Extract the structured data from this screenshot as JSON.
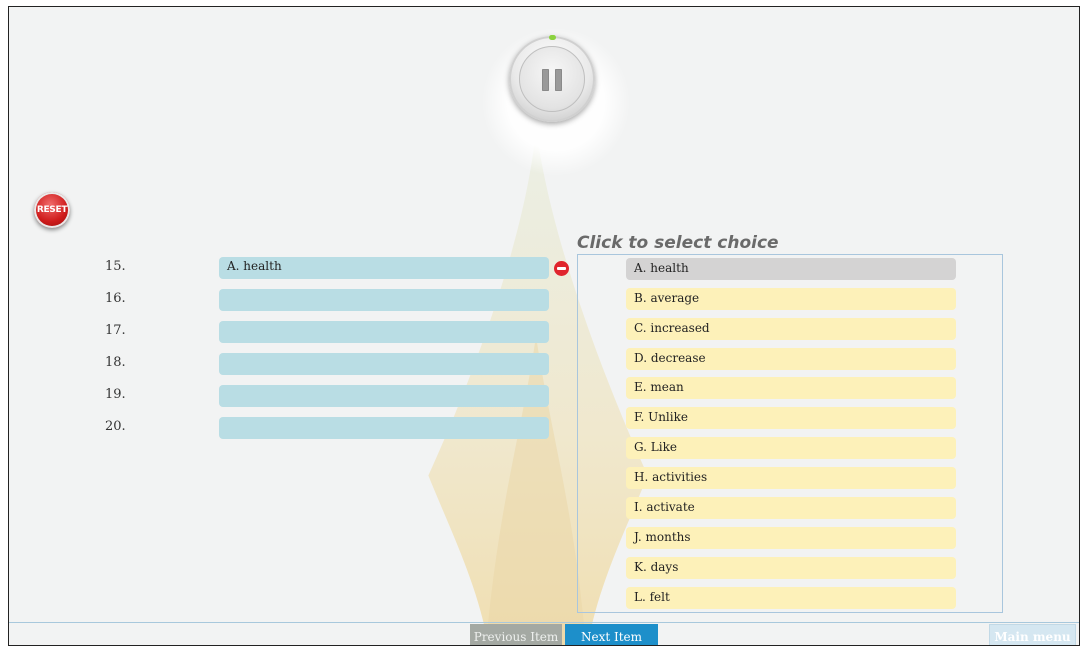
{
  "player": {
    "icon": "pause-icon",
    "progress_color": "#8bd23f"
  },
  "reset": {
    "label": "RESET"
  },
  "questions": [
    {
      "number": "15.",
      "answer": "A. health"
    },
    {
      "number": "16.",
      "answer": ""
    },
    {
      "number": "17.",
      "answer": ""
    },
    {
      "number": "18.",
      "answer": ""
    },
    {
      "number": "19.",
      "answer": ""
    },
    {
      "number": "20.",
      "answer": ""
    }
  ],
  "choices_title": "Click to select choice",
  "choices": [
    {
      "label": "A. health",
      "used": true
    },
    {
      "label": "B. average",
      "used": false
    },
    {
      "label": "C. increased",
      "used": false
    },
    {
      "label": "D. decrease",
      "used": false
    },
    {
      "label": "E. mean",
      "used": false
    },
    {
      "label": "F. Unlike",
      "used": false
    },
    {
      "label": "G. Like",
      "used": false
    },
    {
      "label": "H. activities",
      "used": false
    },
    {
      "label": "I. activate",
      "used": false
    },
    {
      "label": "J. months",
      "used": false
    },
    {
      "label": "K. days",
      "used": false
    },
    {
      "label": "L. felt",
      "used": false
    }
  ],
  "footer": {
    "previous_label": "Previous Item",
    "next_label": "Next Item",
    "menu_label": "Main menu"
  },
  "colors": {
    "slot": "#b9dde4",
    "choice": "#fdf1b9",
    "choice_used": "#d4d3d3",
    "remove": "#e0252d",
    "next": "#1d8fca"
  }
}
